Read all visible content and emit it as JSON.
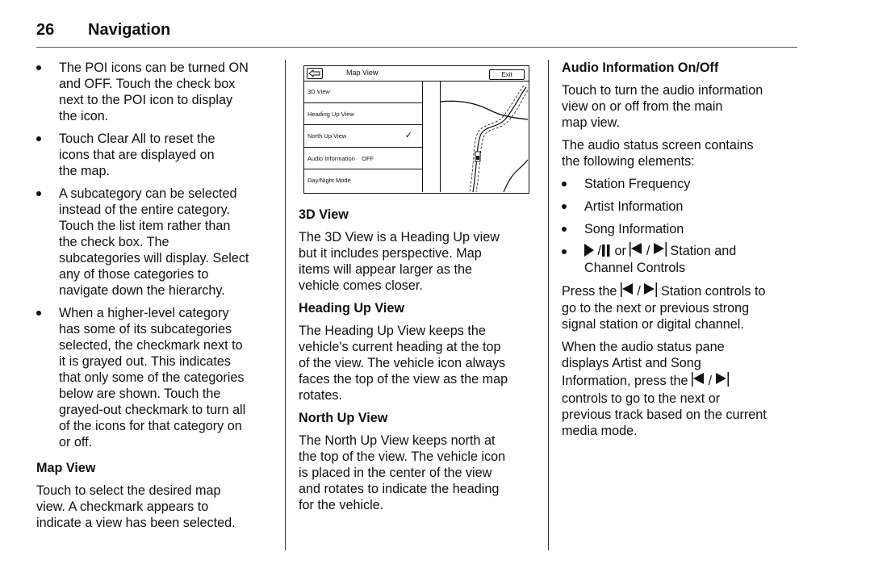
{
  "header": {
    "page_number": "26",
    "section_title": "Navigation"
  },
  "col1": {
    "bullets": [
      {
        "lines": [
          "The POI icons can be turned ON",
          "and OFF. Touch the check box",
          "next to the POI icon to display",
          "the icon."
        ]
      },
      {
        "lines": [
          "Touch Clear All to reset the",
          "icons that are displayed on",
          "the map."
        ]
      },
      {
        "lines": [
          "A subcategory can be selected",
          "instead of the entire category.",
          "Touch the list item rather than",
          "the check box. The",
          "subcategories will display. Select",
          "any of those categories to",
          "navigate down the hierarchy."
        ]
      },
      {
        "lines": [
          "When a higher-level category",
          "has some of its subcategories",
          "selected, the checkmark next to",
          "it is grayed out. This indicates",
          "that only some of the categories",
          "below are shown. Touch the",
          "grayed-out checkmark to turn all",
          "of the icons for that category on",
          "or off."
        ]
      }
    ],
    "map_view_heading": "Map View",
    "map_view_lines": [
      "Touch to select the desired map",
      "view. A checkmark appears to",
      "indicate a view has been selected."
    ]
  },
  "screen": {
    "title": "Map View",
    "back_icon": "back-arrow-icon",
    "exit_label": "Exit",
    "menu_items": [
      {
        "label": "3D View",
        "checked": false
      },
      {
        "label": "Heading Up View",
        "checked": false
      },
      {
        "label": "North Up View",
        "checked": true
      },
      {
        "label": "Audio Information    OFF",
        "checked": false
      },
      {
        "label": "Day/Night Mode",
        "checked": false
      }
    ],
    "check_glyph": "✓"
  },
  "col2": {
    "sections": [
      {
        "heading": "3D View",
        "lines": [
          "The 3D View is a Heading Up view",
          "but it includes perspective. Map",
          "items will appear larger as the",
          "vehicle comes closer."
        ]
      },
      {
        "heading": "Heading Up View",
        "lines": [
          "The Heading Up View keeps the",
          "vehicle's current heading at the top",
          "of the view. The vehicle icon always",
          "faces the top of the view as the map",
          "rotates."
        ]
      },
      {
        "heading": "North Up View",
        "lines": [
          "The North Up View keeps north at",
          "the top of the view. The vehicle icon",
          "is placed in the center of the view",
          "and rotates to indicate the heading",
          "for the vehicle."
        ]
      }
    ]
  },
  "col3": {
    "heading": "Audio Information On/Off",
    "para1_lines": [
      "Touch to turn the audio information",
      "view on or off from the main",
      "map view."
    ],
    "para2_lines": [
      "The audio status screen contains",
      "the following elements:"
    ],
    "bullets": [
      "Station Frequency",
      "Artist Information",
      "Song Information"
    ],
    "controls_bullet": {
      "play_pause_sep": "/",
      "or": "or",
      "seek_sep": "/",
      "tail_line1": "Station and",
      "line2": "Channel Controls"
    },
    "press": {
      "pre": "Press the",
      "sep": "/",
      "post": "Station controls to",
      "lines": [
        "go to the next or previous strong",
        "signal station or digital channel."
      ]
    },
    "when": {
      "lines": [
        "When the audio status pane",
        "displays Artist and Song"
      ],
      "line3_pre": "Information, press the",
      "sep": "/",
      "lines_after": [
        "controls to go to the next or",
        "previous track based on the current",
        "media mode."
      ]
    }
  }
}
